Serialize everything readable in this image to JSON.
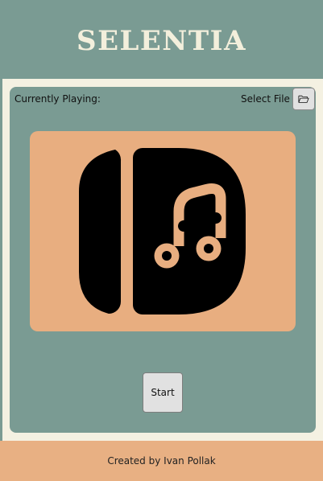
{
  "app": {
    "title": "SELENTIA"
  },
  "player": {
    "now_playing_label": "Currently Playing:",
    "select_file_label": "Select File",
    "select_file_icon": "open-folder-icon",
    "album_art_icon": "music-library-icon",
    "start_label": "Start"
  },
  "footer": {
    "credit": "Created by Ivan Pollak"
  },
  "colors": {
    "header_bg": "#7a9b93",
    "frame_bg": "#f4f1e2",
    "panel_bg": "#7a9b93",
    "art_bg": "#e8ae80",
    "footer_bg": "#e8b083",
    "title_text": "#f3efdc",
    "button_bg": "#e1e1e1"
  }
}
